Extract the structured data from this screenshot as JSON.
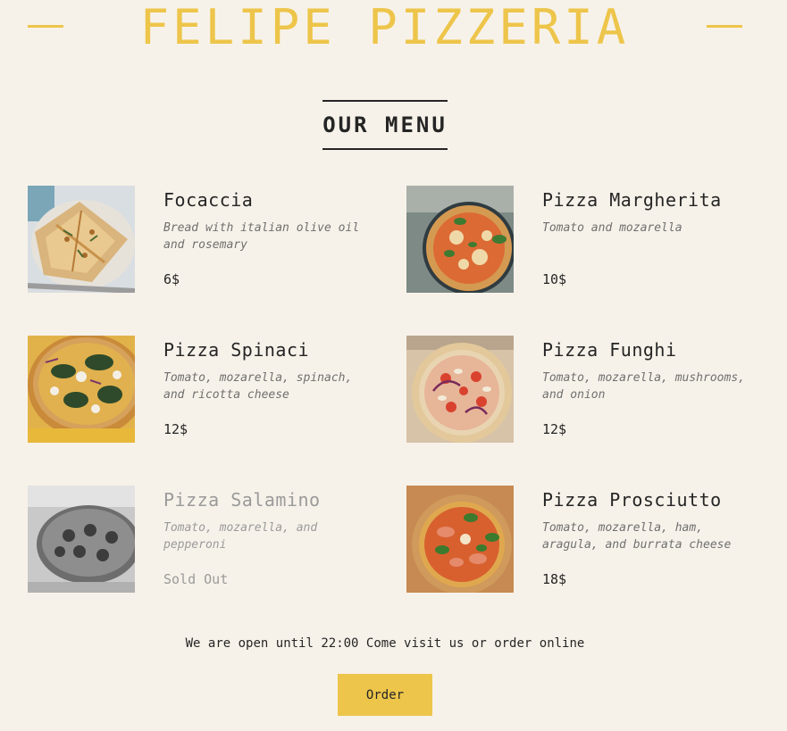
{
  "brand": {
    "title": "FELIPE PIZZERIA",
    "accent_color": "#edc54a"
  },
  "menu": {
    "heading": "OUR MENU",
    "items": [
      {
        "name": "Focaccia",
        "description": "Bread with italian olive oil and rosemary",
        "price": "6$",
        "sold_out": false,
        "image": "focaccia-photo"
      },
      {
        "name": "Pizza Margherita",
        "description": "Tomato and mozarella",
        "price": "10$",
        "sold_out": false,
        "image": "margherita-photo"
      },
      {
        "name": "Pizza Spinaci",
        "description": "Tomato, mozarella, spinach, and ricotta cheese",
        "price": "12$",
        "sold_out": false,
        "image": "spinaci-photo"
      },
      {
        "name": "Pizza Funghi",
        "description": "Tomato, mozarella, mushrooms, and onion",
        "price": "12$",
        "sold_out": false,
        "image": "funghi-photo"
      },
      {
        "name": "Pizza Salamino",
        "description": "Tomato, mozarella, and pepperoni",
        "price": "Sold Out",
        "sold_out": true,
        "image": "salamino-photo"
      },
      {
        "name": "Pizza Prosciutto",
        "description": "Tomato, mozarella, ham, aragula, and burrata cheese",
        "price": "18$",
        "sold_out": false,
        "image": "prosciutto-photo"
      }
    ]
  },
  "footer": {
    "message": "We are open until 22:00 Come visit us or order online",
    "order_label": "Order"
  }
}
